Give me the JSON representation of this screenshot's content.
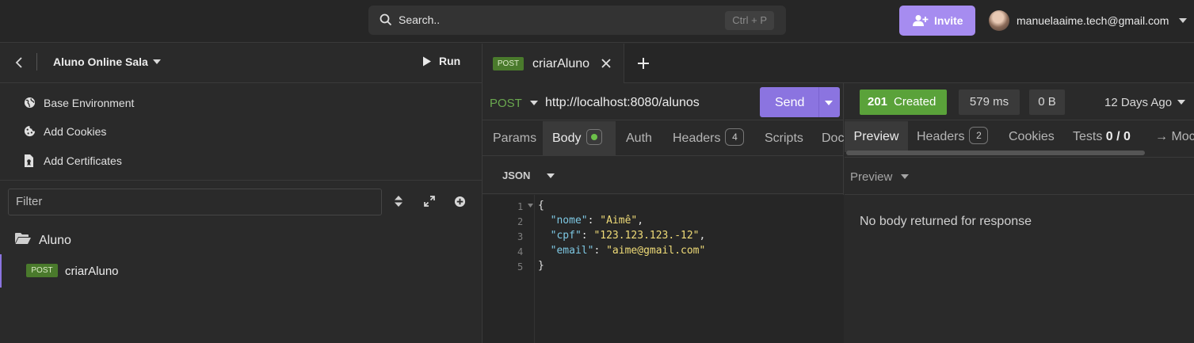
{
  "topbar": {
    "search_label": "Search..",
    "search_shortcut": "Ctrl + P",
    "invite_label": "Invite",
    "user_email": "manuelaaime.tech@gmail.com"
  },
  "sidebar": {
    "workspace_name": "Aluno Online Sala",
    "run_label": "Run",
    "menu": [
      {
        "label": "Base Environment",
        "icon": "globe-icon"
      },
      {
        "label": "Add Cookies",
        "icon": "cookie-icon"
      },
      {
        "label": "Add Certificates",
        "icon": "certificate-icon"
      }
    ],
    "filter_placeholder": "Filter",
    "folder_name": "Aluno",
    "request": {
      "method": "POST",
      "name": "criarAluno"
    }
  },
  "tab": {
    "method": "POST",
    "name": "criarAluno"
  },
  "request": {
    "method": "POST",
    "url": "http://localhost:8080/alunos",
    "send_label": "Send",
    "tabs": [
      "Params",
      "Body",
      "Auth",
      "Headers",
      "Scripts",
      "Doc"
    ],
    "headers_count": "4",
    "body_type": "JSON",
    "body_lines": [
      {
        "n": "1",
        "text": "{"
      },
      {
        "n": "2",
        "key": "\"nome\"",
        "value": "\"Aimê\"",
        "sep": ","
      },
      {
        "n": "3",
        "key": "\"cpf\"",
        "value": "\"123.123.123.-12\"",
        "sep": ","
      },
      {
        "n": "4",
        "key": "\"email\"",
        "value": "\"aime@gmail.com\"",
        "sep": ""
      },
      {
        "n": "5",
        "text": "}"
      }
    ]
  },
  "response": {
    "status_code": "201",
    "status_text": "Created",
    "time": "579 ms",
    "size": "0 B",
    "age": "12 Days Ago",
    "tabs": [
      "Preview",
      "Headers",
      "Cookies",
      "Tests",
      "→ Mock"
    ],
    "headers_count": "2",
    "tests_count": "0 / 0",
    "preview_mode": "Preview",
    "empty_message": "No body returned for response"
  },
  "colors": {
    "accent": "#8b74e0",
    "success": "#5aa23a",
    "post_method": "#6aa84f"
  }
}
